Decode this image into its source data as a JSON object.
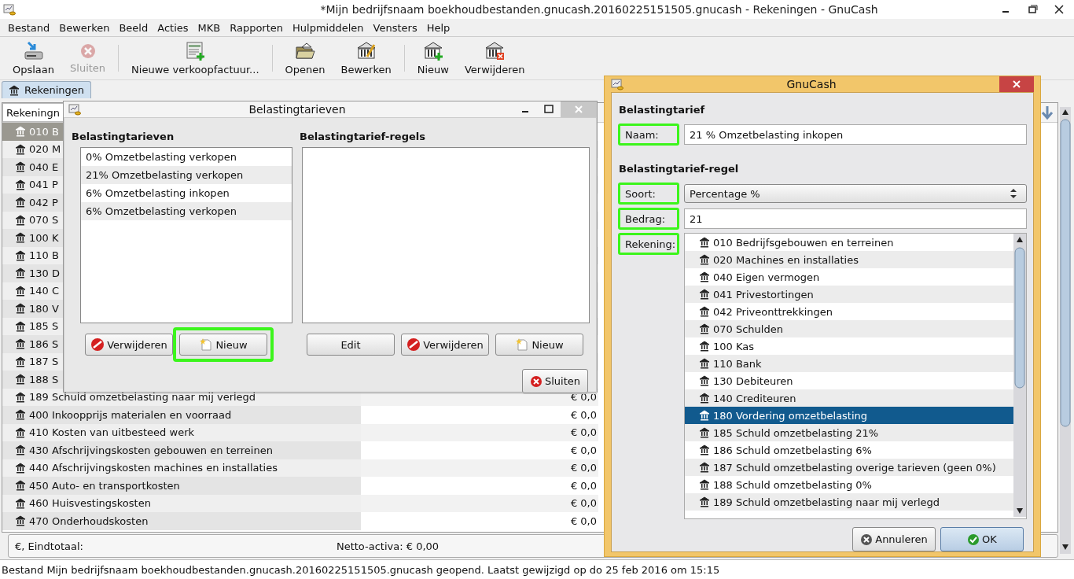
{
  "window": {
    "title": "*Mijn bedrijfsnaam boekhoudbestanden.gnucash.20160225151505.gnucash - Rekeningen - GnuCash"
  },
  "menu": [
    "Bestand",
    "Bewerken",
    "Beeld",
    "Acties",
    "MKB",
    "Rapporten",
    "Hulpmiddelen",
    "Vensters",
    "Help"
  ],
  "toolbar": [
    {
      "items": [
        {
          "label": "Opslaan",
          "kind": "save",
          "disabled": false
        },
        {
          "label": "Sluiten",
          "kind": "close",
          "disabled": true
        }
      ]
    },
    {
      "items": [
        {
          "label": "Nieuwe verkoopfactuur...",
          "kind": "invoice",
          "disabled": false
        }
      ]
    },
    {
      "items": [
        {
          "label": "Openen",
          "kind": "open",
          "disabled": false
        },
        {
          "label": "Bewerken",
          "kind": "edit",
          "disabled": false
        }
      ]
    },
    {
      "items": [
        {
          "label": "Nieuw",
          "kind": "new",
          "disabled": false
        },
        {
          "label": "Verwijderen",
          "kind": "delete",
          "disabled": false
        }
      ]
    }
  ],
  "tabs": [
    {
      "label": "Rekeningen",
      "selected": true
    }
  ],
  "accounts": {
    "column_1": "Rekeningn",
    "rows": [
      {
        "name": "010 B",
        "selected": true
      },
      {
        "name": "020 M",
        "selected": false
      },
      {
        "name": "040 E",
        "selected": false
      },
      {
        "name": "041 P",
        "selected": false
      },
      {
        "name": "042 P",
        "selected": false
      },
      {
        "name": "070 S",
        "selected": false
      },
      {
        "name": "100 K",
        "selected": false
      },
      {
        "name": "110 B",
        "selected": false
      },
      {
        "name": "130 D",
        "selected": false
      },
      {
        "name": "140 C",
        "selected": false
      },
      {
        "name": "180 V",
        "selected": false
      },
      {
        "name": "185 S",
        "selected": false
      },
      {
        "name": "186 S",
        "selected": false
      },
      {
        "name": "187 S",
        "selected": false
      },
      {
        "name": "188 S",
        "selected": false
      },
      {
        "name": "189 Schuld omzetbelasting naar mij verlegd",
        "amount": "€ 0,0",
        "selected": false
      },
      {
        "name": "400 Inkoopprijs materialen en voorraad",
        "amount": "€ 0,0",
        "selected": false
      },
      {
        "name": "410 Kosten van uitbesteed werk",
        "amount": "€ 0,0",
        "selected": false
      },
      {
        "name": "430 Afschrijvingskosten gebouwen en terreinen",
        "amount": "€ 0,0",
        "selected": false
      },
      {
        "name": "440 Afschrijvingskosten machines en installaties",
        "amount": "€ 0,0",
        "selected": false
      },
      {
        "name": "450 Auto- en transportkosten",
        "amount": "€ 0,0",
        "selected": false
      },
      {
        "name": "460 Huisvestingskosten",
        "amount": "€ 0,0",
        "selected": false
      },
      {
        "name": "470 Onderhoudskosten",
        "amount": "€ 0,0",
        "selected": false
      }
    ]
  },
  "summary": {
    "label": "€, Eindtotaal:",
    "net": "Netto-activa: € 0,00"
  },
  "status_bar": "Bestand Mijn bedrijfsnaam boekhoudbestanden.gnucash.20160225151505.gnucash geopend. Laatst gewijzigd op do 25 feb 2016 om 15:15",
  "tax_dialog": {
    "title": "Belastingtarieven",
    "tables_heading": "Belastingtarieven",
    "tables": [
      "0% Omzetbelasting verkopen",
      "21% Omzetbelasting verkopen",
      "6% Omzetbelasting inkopen",
      "6% Omzetbelasting verkopen"
    ],
    "left_buttons": [
      {
        "label": "Verwijderen",
        "kind": "delete",
        "highlighted": false
      },
      {
        "label": "Nieuw",
        "kind": "new",
        "highlighted": true
      }
    ],
    "rules_heading": "Belastingtarief-regels",
    "right_buttons": [
      {
        "label": "Edit",
        "kind": "plain",
        "highlighted": false
      },
      {
        "label": "Verwijderen",
        "kind": "delete",
        "highlighted": false
      },
      {
        "label": "Nieuw",
        "kind": "new",
        "highlighted": false
      }
    ],
    "close_button": "Sluiten"
  },
  "edit_dialog": {
    "title": "GnuCash",
    "heading": "Belastingtarief",
    "name_label": {
      "label": "Naam:",
      "highlighted": true
    },
    "name_value": "21 % Omzetbelasting inkopen",
    "rule_heading": "Belastingtarief-regel",
    "type_label": {
      "label": "Soort:",
      "highlighted": true
    },
    "type_value": "Percentage %",
    "amount_label": {
      "label": "Bedrag:",
      "highlighted": true
    },
    "amount_value": "21",
    "account_label": {
      "label": "Rekening:",
      "highlighted": true
    },
    "accounts": [
      {
        "name": "010 Bedrijfsgebouwen en terreinen",
        "selected": false
      },
      {
        "name": "020 Machines en installaties",
        "selected": false
      },
      {
        "name": "040 Eigen vermogen",
        "selected": false
      },
      {
        "name": "041 Privestortingen",
        "selected": false
      },
      {
        "name": "042 Priveonttrekkingen",
        "selected": false
      },
      {
        "name": "070 Schulden",
        "selected": false
      },
      {
        "name": "100 Kas",
        "selected": false
      },
      {
        "name": "110 Bank",
        "selected": false
      },
      {
        "name": "130 Debiteuren",
        "selected": false
      },
      {
        "name": "140 Crediteuren",
        "selected": false
      },
      {
        "name": "180 Vordering omzetbelasting",
        "selected": true
      },
      {
        "name": "185 Schuld omzetbelasting 21%",
        "selected": false
      },
      {
        "name": "186 Schuld omzetbelasting 6%",
        "selected": false
      },
      {
        "name": "187 Schuld omzetbelasting overige tarieven (geen 0%)",
        "selected": false
      },
      {
        "name": "188 Schuld omzetbelasting 0%",
        "selected": false
      },
      {
        "name": "189 Schuld omzetbelasting naar mij verlegd",
        "selected": false
      }
    ],
    "buttons": [
      {
        "label": "Annuleren",
        "kind": "cancel"
      },
      {
        "label": "OK",
        "kind": "ok"
      }
    ]
  }
}
